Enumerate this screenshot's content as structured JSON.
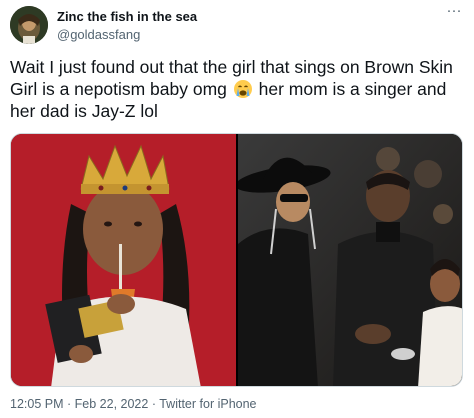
{
  "author": {
    "display_name": "Zinc the fish in the sea",
    "handle": "@goldassfang"
  },
  "tweet": {
    "text_part1": "Wait I just found out that the girl that sings on Brown Skin Girl is a nepotism baby omg",
    "emoji": "crying-face-emoji",
    "text_part2": "her mom is a singer and her dad is Jay-Z lol"
  },
  "meta": {
    "time": "12:05 PM",
    "separator": "·",
    "date": "Feb 22, 2022",
    "source": "Twitter for iPhone"
  },
  "icons": {
    "more": "more-options-icon"
  },
  "colors": {
    "text": "#0f1419",
    "secondary": "#536471",
    "left_photo_bg": "#b81f2a"
  }
}
